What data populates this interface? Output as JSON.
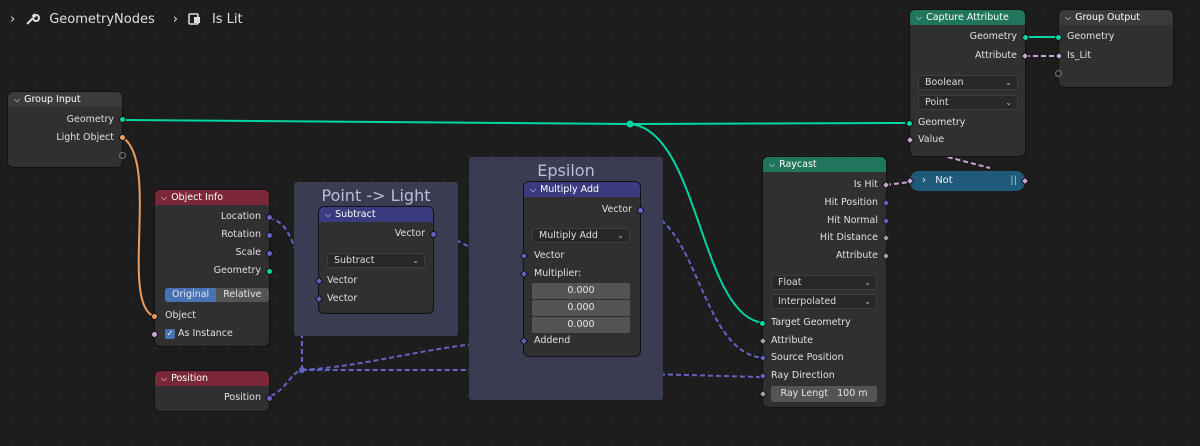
{
  "breadcrumb": {
    "tree_name": "GeometryNodes",
    "group_name": "Is Lit",
    "tree_icon": "wrench-icon",
    "group_icon": "node-group-icon"
  },
  "colors": {
    "geometry_socket": "#00d6a3",
    "vector_socket": "#6363c7",
    "object_socket": "#ed9e5c",
    "boolean_socket": "#cca6d6",
    "input_header": "#7a2837",
    "vector_header": "#3b3b82",
    "geometry_header": "#20765c",
    "output_header": "#3b3b3b"
  },
  "frames": {
    "point_light": "Point -> Light",
    "epsilon": "Epsilon"
  },
  "group_input": {
    "title": "Group Input",
    "outputs": [
      "Geometry",
      "Light Object"
    ]
  },
  "object_info": {
    "title": "Object Info",
    "outputs": [
      "Location",
      "Rotation",
      "Scale",
      "Geometry"
    ],
    "toggle": [
      "Original",
      "Relative"
    ],
    "inputs": [
      "Object",
      "As Instance"
    ]
  },
  "position": {
    "title": "Position",
    "output": "Position"
  },
  "subtract": {
    "title": "Subtract",
    "output": "Vector",
    "operation": "Subtract",
    "inputs": [
      "Vector",
      "Vector"
    ]
  },
  "multiply_add": {
    "title": "Multiply Add",
    "output": "Vector",
    "operation": "Multiply Add",
    "inputs": [
      "Vector",
      "Multiplier:"
    ],
    "multiplier": [
      "0.000",
      "0.000",
      "0.000"
    ],
    "addend": "Addend"
  },
  "raycast": {
    "title": "Raycast",
    "outputs": [
      "Is Hit",
      "Hit Position",
      "Hit Normal",
      "Hit Distance",
      "Attribute"
    ],
    "data_type": "Float",
    "mapping": "Interpolated",
    "inputs": [
      "Target Geometry",
      "Attribute",
      "Source Position",
      "Ray Direction"
    ],
    "ray_length_label": "Ray Lengt",
    "ray_length_value": "100 m"
  },
  "capture_attribute": {
    "title": "Capture Attribute",
    "outputs": [
      "Geometry",
      "Attribute"
    ],
    "data_type": "Boolean",
    "domain": "Point",
    "inputs": [
      "Geometry",
      "Value"
    ]
  },
  "group_output": {
    "title": "Group Output",
    "inputs": [
      "Geometry",
      "Is_Lit"
    ]
  },
  "not_node": {
    "label": "Not"
  }
}
